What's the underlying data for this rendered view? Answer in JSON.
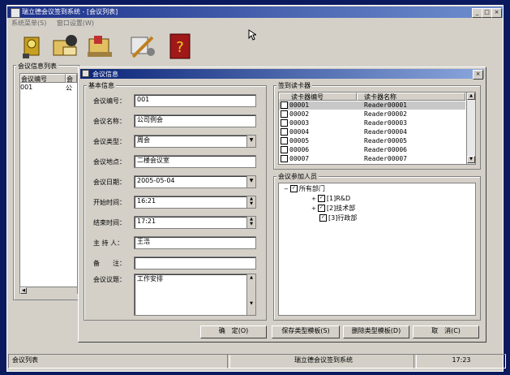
{
  "window": {
    "title": "瑞立德会议签到系统 - [会议列表]",
    "controls": [
      "_",
      "□",
      "×"
    ]
  },
  "menu": [
    "系统菜单(S)",
    "窗口设置(W)"
  ],
  "toolbar_icons": [
    "gear-cube-icon",
    "envelope-person-icon",
    "envelope-tray-icon",
    "tools-icon",
    "help-book-icon"
  ],
  "list_panel": {
    "title": "会议信息列表",
    "columns": [
      "会议编号",
      "会"
    ],
    "rows": [
      [
        "001",
        "公"
      ]
    ]
  },
  "dialog": {
    "title": "会议信息",
    "basic_group": "基本信息",
    "fields": {
      "meeting_no": {
        "label": "会议编号：",
        "value": "001"
      },
      "meeting_name": {
        "label": "会议名称：",
        "value": "公司例会"
      },
      "meeting_type": {
        "label": "会议类型：",
        "value": "周会"
      },
      "meeting_place": {
        "label": "会议地点：",
        "value": "二楼会议室"
      },
      "meeting_date": {
        "label": "会议日期：",
        "value": "2005-05-04"
      },
      "start_time": {
        "label": "开始时间：",
        "value": "16:21"
      },
      "end_time": {
        "label": "结束时间：",
        "value": "17:21"
      },
      "host": {
        "label": "主 持 人：",
        "value": "王浩"
      },
      "remarks": {
        "label": "备　　注：",
        "value": ""
      },
      "topics": {
        "label": "会议议题：",
        "value": "工作安排"
      }
    },
    "reader_group": {
      "title": "签到读卡器",
      "columns": [
        "读卡器编号",
        "读卡器名称"
      ],
      "rows": [
        [
          "00001",
          "Reader00001"
        ],
        [
          "00002",
          "Reader00002"
        ],
        [
          "00003",
          "Reader00003"
        ],
        [
          "00004",
          "Reader00004"
        ],
        [
          "00005",
          "Reader00005"
        ],
        [
          "00006",
          "Reader00006"
        ],
        [
          "00007",
          "Reader00007"
        ]
      ]
    },
    "attendee_group": {
      "title": "会议参加人员",
      "tree": [
        {
          "label": "所有部门",
          "level": 0
        },
        {
          "label": "[1]R&D",
          "level": 1
        },
        {
          "label": "[2]技术部",
          "level": 1
        },
        {
          "label": "[3]行政部",
          "level": 1
        }
      ]
    },
    "buttons": {
      "ok": "确　定(O)",
      "save_template": "保存类型模板(S)",
      "delete_template": "删除类型模板(D)",
      "cancel": "取　消(C)"
    }
  },
  "status": {
    "left": "会议列表",
    "center": "瑞立德会议签到系统",
    "time": "17:23"
  }
}
